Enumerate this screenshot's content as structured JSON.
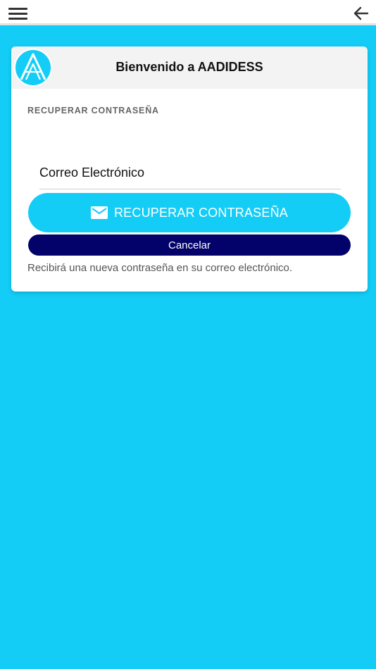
{
  "topbar": {
    "menu_icon": "hamburger-menu-icon",
    "back_icon": "arrow-left-icon"
  },
  "card": {
    "logo_icon": "aadidess-logo",
    "title": "Bienvenido a AADIDESS",
    "section_label": "RECUPERAR CONTRASEÑA",
    "email_field": {
      "placeholder": "Correo Electrónico",
      "value": ""
    },
    "recover_button": {
      "icon": "mail-icon",
      "label": "RECUPERAR CONTRASEÑA"
    },
    "cancel_button": {
      "label": "Cancelar"
    },
    "hint": "Recibirá una nueva contraseña en su correo electrónico."
  },
  "colors": {
    "background": "#13cdf7",
    "accent": "#13cdf7",
    "cancel": "#02026a",
    "card": "#ffffff"
  }
}
